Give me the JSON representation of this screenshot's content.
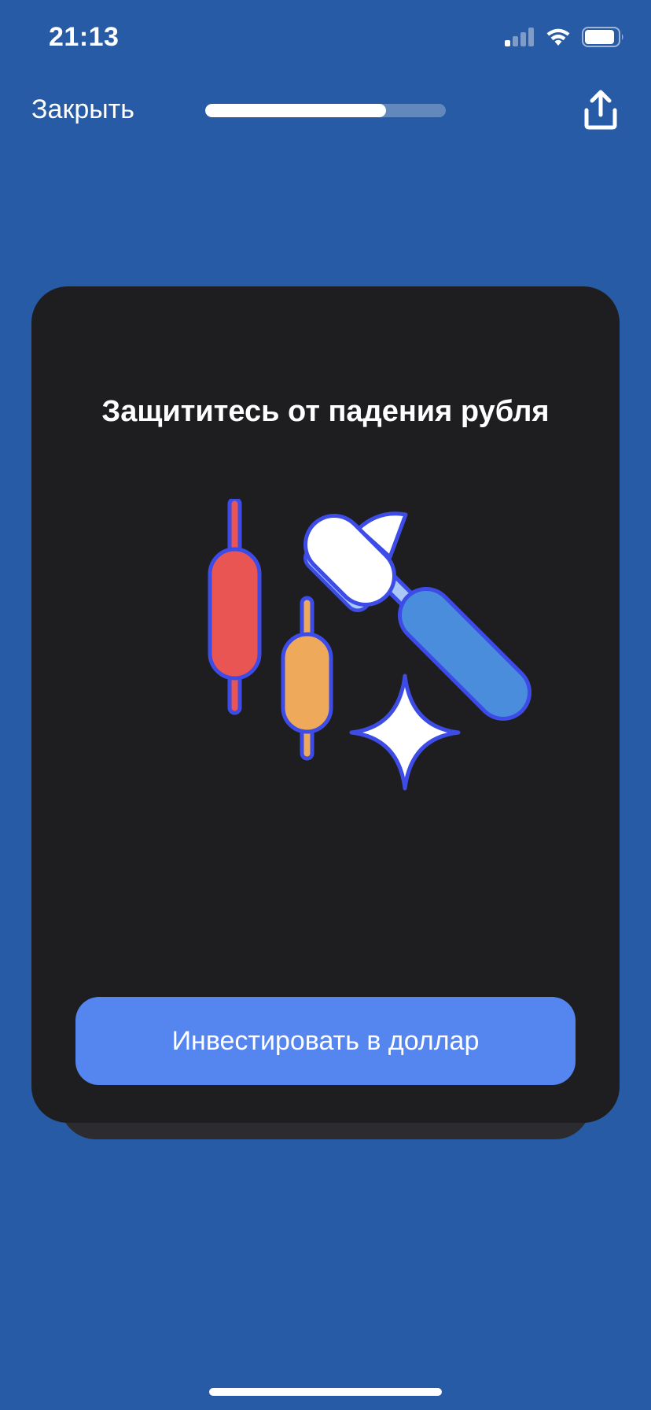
{
  "status_bar": {
    "time": "21:13",
    "icons": [
      "signal-icon",
      "wifi-icon",
      "battery-icon"
    ]
  },
  "topbar": {
    "close_label": "Закрыть",
    "progress": 0.75,
    "share_icon": "share-icon"
  },
  "card": {
    "title": "Защититесь от падения рубля",
    "illustration_icon": "candlestick-hammer-icon",
    "button_label": "Инвестировать в доллар"
  },
  "colors": {
    "background": "#285ba5",
    "card": "#1e1e20",
    "button": "#5585ef",
    "candle_red": "#e85552",
    "candle_orange": "#eeaa5a",
    "outline": "#3d4ce6",
    "hammer_handle": "#4a8ddc"
  }
}
